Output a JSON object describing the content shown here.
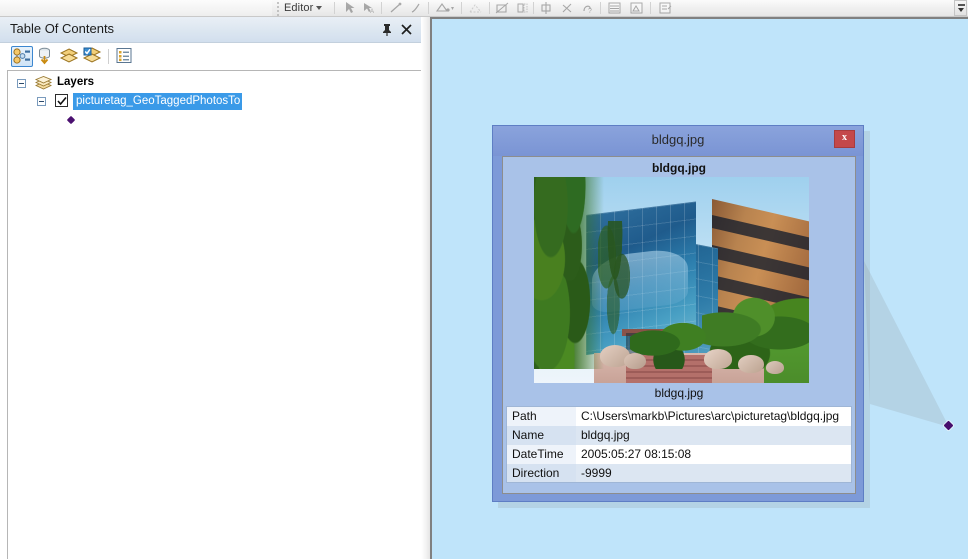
{
  "toolbar": {
    "editor_menu_label": "Editor",
    "icons": [
      {
        "name": "edit-tool-arrow-icon"
      },
      {
        "name": "edit-annotation-icon"
      },
      {
        "name": "straight-segment-icon"
      },
      {
        "name": "trace-icon"
      },
      {
        "name": "construction-tools-icon"
      },
      {
        "name": "mid-point-icon"
      },
      {
        "name": "split-icon"
      },
      {
        "name": "rotate-icon"
      },
      {
        "name": "union-icon"
      },
      {
        "name": "clip-icon"
      },
      {
        "name": "undo-sketch-icon"
      },
      {
        "name": "attributes-table-icon"
      },
      {
        "name": "sketch-properties-icon"
      },
      {
        "name": "create-features-icon"
      }
    ],
    "overflow_label": "toolbar-overflow"
  },
  "toc": {
    "title": "Table Of Contents",
    "pin_tooltip": "Auto Hide",
    "close_tooltip": "Close",
    "toolbar_buttons": [
      {
        "name": "list-by-drawing-order-button",
        "selected": true
      },
      {
        "name": "list-by-source-button",
        "selected": false
      },
      {
        "name": "list-by-visibility-button",
        "selected": false
      },
      {
        "name": "list-by-selection-button",
        "selected": false
      },
      {
        "name": "toc-options-button",
        "selected": false
      }
    ],
    "tree": {
      "root_label": "Layers",
      "layer_label": "picturetag_GeoTaggedPhotosTo",
      "layer_checked": true,
      "symbol": "point-marker-diamond"
    }
  },
  "map": {
    "background_color": "#bfe4fa",
    "point_marker_color": "#470e6c"
  },
  "popup": {
    "title": "bldgq.jpg",
    "close_label": "x",
    "body_heading": "bldgq.jpg",
    "photo_caption": "bldgq.jpg",
    "photo_alt": "office-building-photo",
    "attributes": [
      {
        "key": "Path",
        "value": "C:\\Users\\markb\\Pictures\\arc\\picturetag\\bldgq.jpg"
      },
      {
        "key": "Name",
        "value": "bldgq.jpg"
      },
      {
        "key": "DateTime",
        "value": "2005:05:27 08:15:08"
      },
      {
        "key": "Direction",
        "value": "-9999"
      }
    ]
  }
}
